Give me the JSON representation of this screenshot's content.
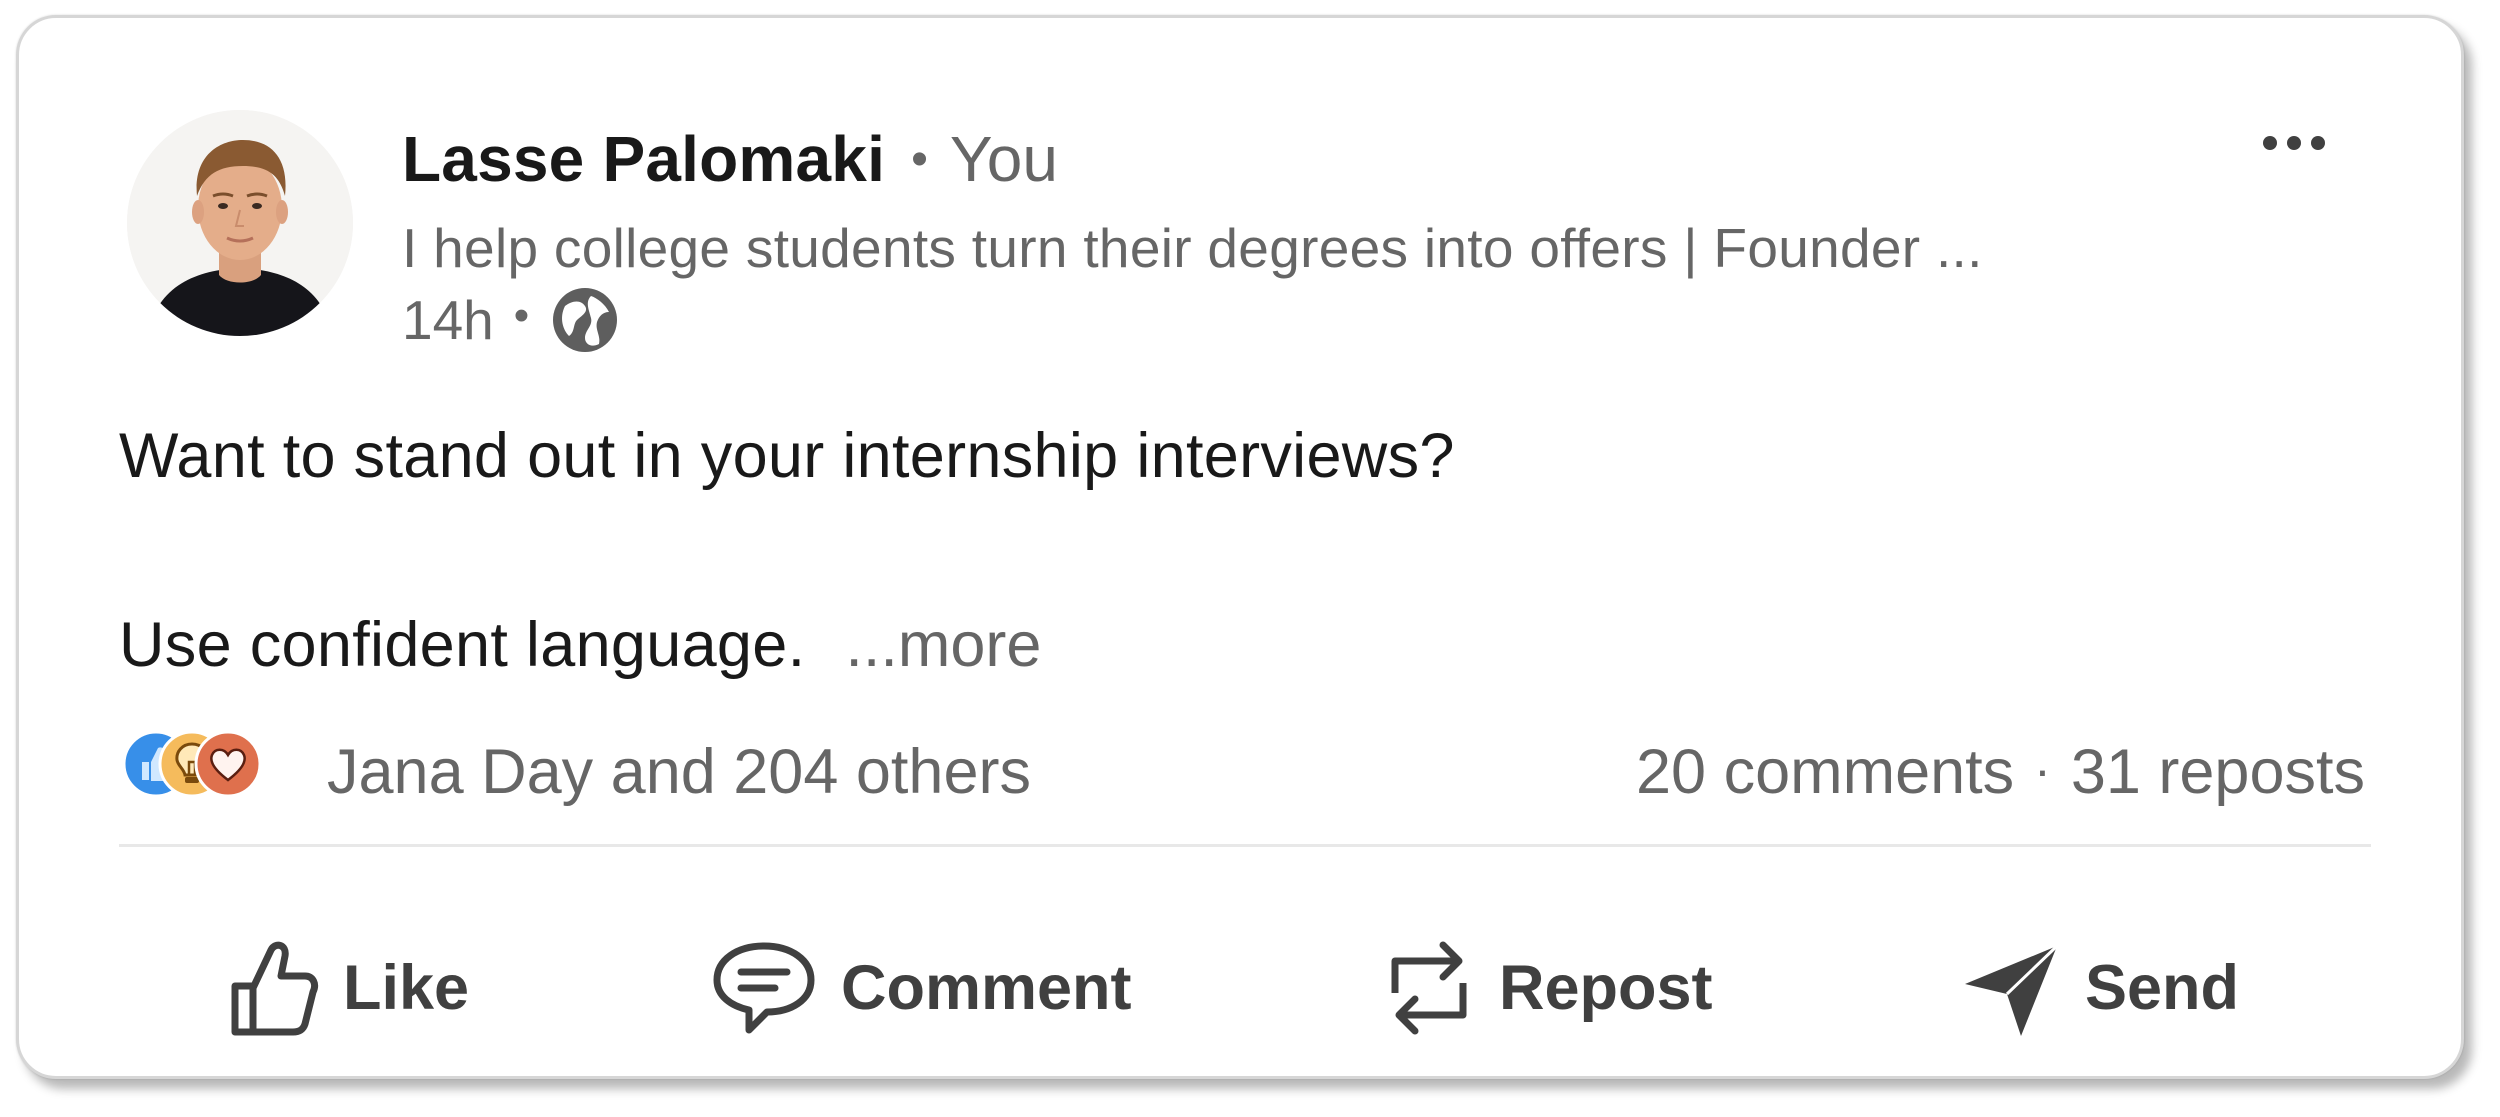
{
  "post": {
    "author": {
      "name": "Lasse Palomaki",
      "separator": "•",
      "relation": "You",
      "headline": "I help college students turn their degrees into offers | Founder ...",
      "timestamp": "14h",
      "visibility_icon": "globe-icon"
    },
    "body": {
      "line1": "Want to stand out in your internship interviews?",
      "line2": "Use confident language.",
      "see_more": "...more"
    },
    "social": {
      "reaction_icons": [
        "like-reaction-icon",
        "insightful-reaction-icon",
        "love-reaction-icon"
      ],
      "reactions_text": "Jana Day and 204 others",
      "comments": "20 comments",
      "separator": "·",
      "reposts": "31 reposts"
    },
    "actions": [
      {
        "label": "Like",
        "icon": "thumbs-up-icon"
      },
      {
        "label": "Comment",
        "icon": "comment-icon"
      },
      {
        "label": "Repost",
        "icon": "repost-icon"
      },
      {
        "label": "Send",
        "icon": "send-icon"
      }
    ],
    "menu_icon": "more-options-icon"
  },
  "colors": {
    "like_blue": "#378fe9",
    "insight_yellow": "#f5bb5c",
    "love_red": "#df704d",
    "text_primary": "#191919",
    "text_secondary": "#666666",
    "action_text": "#404040"
  }
}
